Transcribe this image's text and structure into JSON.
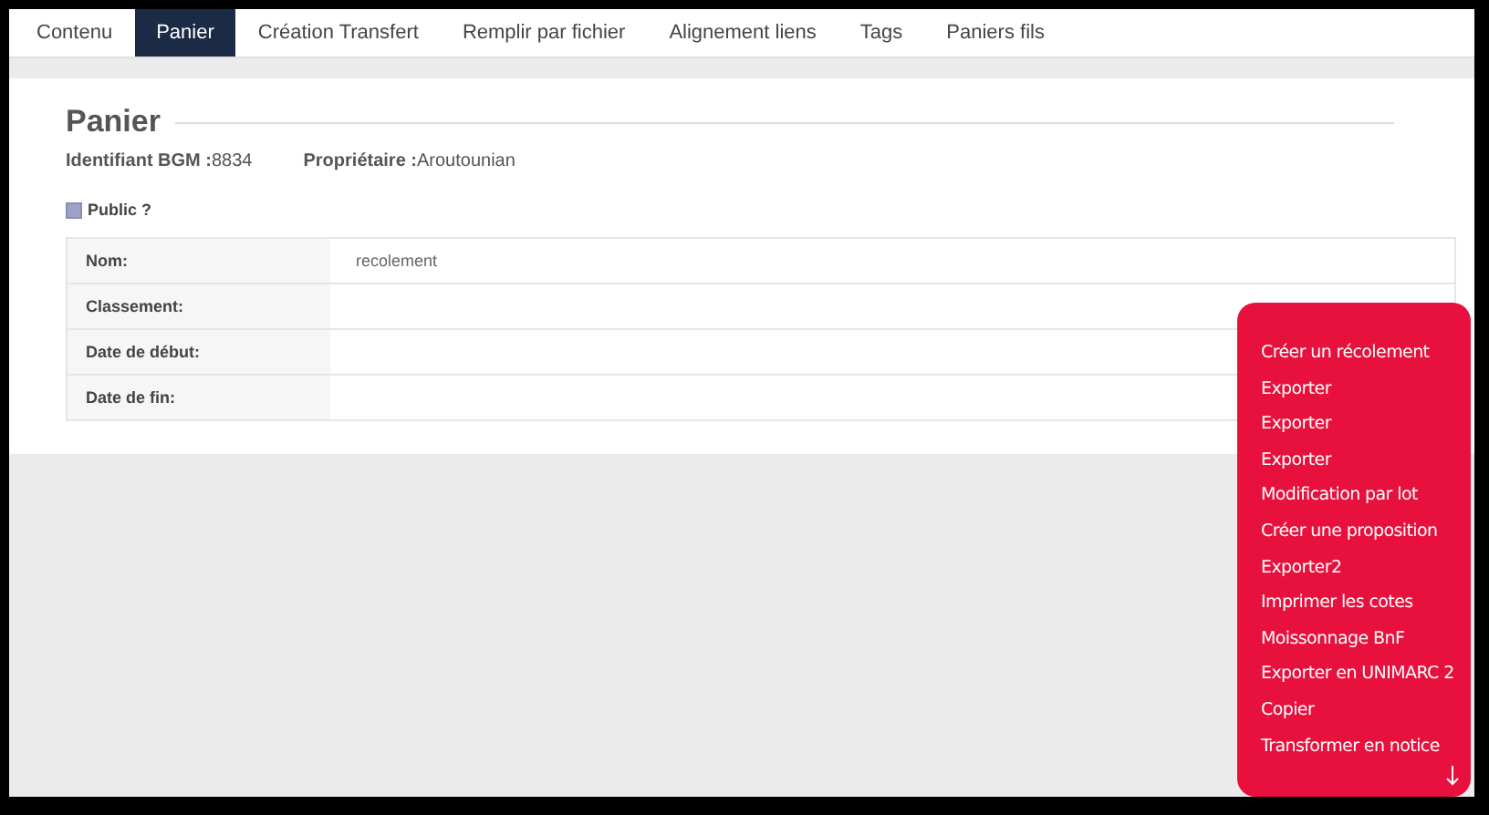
{
  "tabs": [
    {
      "label": "Contenu",
      "selected": false
    },
    {
      "label": "Panier",
      "selected": true
    },
    {
      "label": "Création Transfert",
      "selected": false
    },
    {
      "label": "Remplir par fichier",
      "selected": false
    },
    {
      "label": "Alignement liens",
      "selected": false
    },
    {
      "label": "Tags",
      "selected": false
    },
    {
      "label": "Paniers fils",
      "selected": false
    }
  ],
  "panel": {
    "title": "Panier",
    "info": [
      {
        "label": "Identifiant BGM :",
        "value": "8834"
      },
      {
        "label": "Propriétaire :",
        "value": "Aroutounian"
      }
    ],
    "public": {
      "label": "Public ?",
      "checked": false
    },
    "fields": [
      {
        "label": "Nom:",
        "value": "recolement"
      },
      {
        "label": "Classement:"
      },
      {
        "label": "Date de début:"
      },
      {
        "label": "Date de fin:"
      }
    ]
  },
  "actions_menu": {
    "items": [
      "Créer un récolement",
      "Exporter",
      "Exporter",
      "Exporter",
      "Modification par lot",
      "Créer une proposition",
      "Exporter2",
      "Imprimer les cotes",
      "Moissonnage BnF",
      "Exporter en UNIMARC 2",
      "Copier",
      "Transformer en notice"
    ]
  }
}
